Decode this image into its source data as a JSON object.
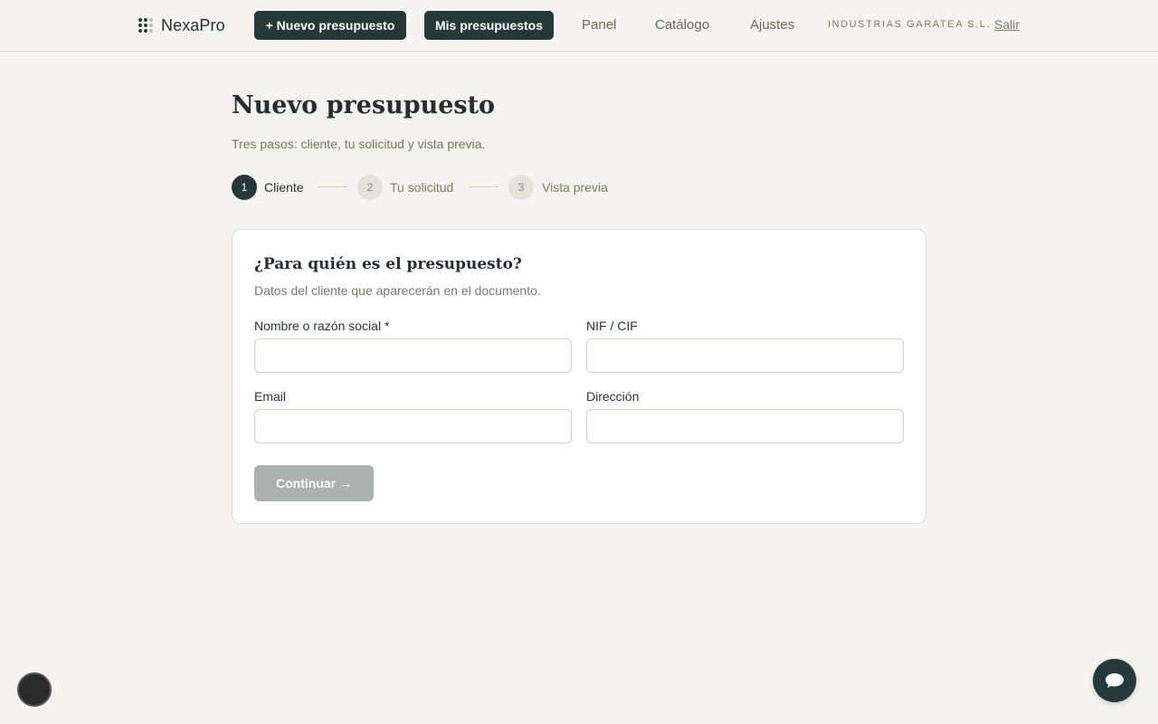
{
  "header": {
    "brand": "NexaPro",
    "new_quote_label": "+ Nuevo presupuesto",
    "my_quotes_label": "Mis presupuestos",
    "nav": [
      "Panel",
      "Catálogo",
      "Ajustes"
    ],
    "company": "INDUSTRIAS GARATEA S.L.",
    "logout_label": "Salir"
  },
  "page": {
    "title": "Nuevo presupuesto",
    "subtitle": "Tres pasos: cliente, tu solicitud y vista previa."
  },
  "steps": [
    {
      "number": "1",
      "label": "Cliente",
      "state": "active"
    },
    {
      "number": "2",
      "label": "Tu solicitud",
      "state": "idle"
    },
    {
      "number": "3",
      "label": "Vista previa",
      "state": "idle"
    }
  ],
  "form": {
    "title": "¿Para quién es el presupuesto?",
    "subtitle": "Datos del cliente que aparecerán en el documento.",
    "fields": {
      "name": {
        "label": "Nombre o razón social *",
        "value": ""
      },
      "nif": {
        "label": "NIF / CIF",
        "value": ""
      },
      "email": {
        "label": "Email",
        "value": ""
      },
      "address": {
        "label": "Dirección",
        "value": ""
      }
    },
    "continue_label": "Continuar →"
  },
  "colors": {
    "accent": "#253a38",
    "background": "#f4f3ef",
    "disabled_button": "#a9b2ae"
  },
  "icons": {
    "logo": "grid-dots-icon",
    "chat": "chat-bubble-icon"
  }
}
